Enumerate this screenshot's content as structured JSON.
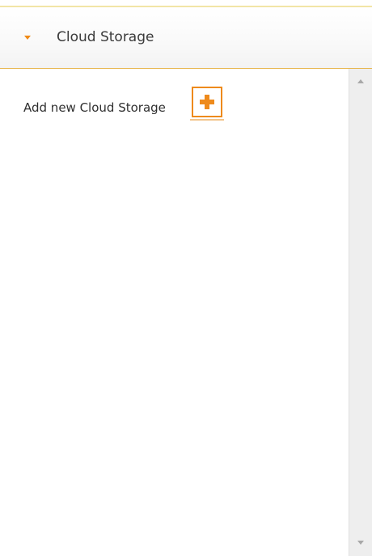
{
  "panel": {
    "title": "Cloud Storage",
    "expanded": true
  },
  "add_storage": {
    "label": "Add new Cloud Storage",
    "icon": "plus-icon"
  },
  "icons": {
    "header_toggle": "chevron-down-icon",
    "scroll_up": "scroll-up-arrow-icon",
    "scroll_down": "scroll-down-arrow-icon"
  },
  "colors": {
    "accent": "#ee8a1c",
    "header_border": "#e7b64d",
    "text": "#3a3a3a",
    "scrollbar": "#eeeeee"
  }
}
